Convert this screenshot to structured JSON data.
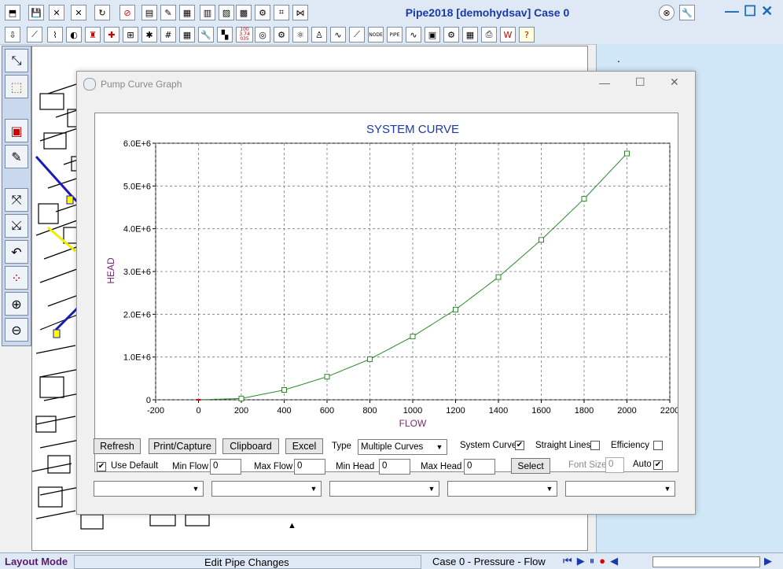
{
  "app": {
    "title": "Pipe2018   [demohydsav]    Case 0",
    "window_controls": {
      "minimize": "—",
      "maximize": "☐",
      "close": "✕"
    }
  },
  "toolbar1_icons": [
    "open-icon",
    "save-icon",
    "delete-pipe-icon",
    "delete-node-icon",
    "refresh-icon",
    "cancel-icon",
    "folder-icon",
    "edit-icon",
    "table-icon",
    "report-icon",
    "chart-icon",
    "notes-icon",
    "tools-icon",
    "map-icon"
  ],
  "toolbar2_icons": [
    "import-icon",
    "pipe-draw-icon",
    "graph-icon",
    "pump-icon",
    "hydrant-icon",
    "valve-icon",
    "grid-icon",
    "network-icon",
    "grid2-icon",
    "color-grid-icon",
    "wrench-icon",
    "checker-icon",
    "numbers-icon",
    "dial-icon",
    "gear-icon",
    "settings-icon",
    "person-icon",
    "wave-icon",
    "ruler-icon",
    "node-icon",
    "pipe-icon",
    "pulse-icon",
    "lock-icon",
    "calendar-icon",
    "printer-icon",
    "word-icon",
    "help-icon"
  ],
  "toolbar2_text": {
    "numbers": "100 3.74 035",
    "node": "NODE",
    "pipe": "PIPE"
  },
  "map_note": ".",
  "dialog": {
    "title": "Pump Curve Graph",
    "buttons": {
      "refresh": "Refresh",
      "print": "Print/Capture",
      "clipboard": "Clipboard",
      "excel": "Excel",
      "select": "Select"
    },
    "type_label": "Type",
    "type_value": "Multiple Curves",
    "system_curve_label": "System Curve",
    "system_curve_checked": true,
    "straight_lines_label": "Straight Lines",
    "straight_lines_checked": false,
    "efficiency_label": "Efficiency",
    "efficiency_checked": false,
    "use_default_label": "Use Default",
    "use_default_checked": true,
    "min_flow_label": "Min Flow",
    "min_flow_value": "0",
    "max_flow_label": "Max Flow",
    "max_flow_value": "0",
    "min_head_label": "Min Head",
    "min_head_value": "0",
    "max_head_label": "Max Head",
    "max_head_value": "0",
    "font_size_label": "Font Size",
    "font_size_value": "0",
    "auto_label": "Auto",
    "auto_checked": true
  },
  "chart_data": {
    "type": "line",
    "title": "SYSTEM CURVE",
    "xlabel": "FLOW",
    "ylabel": "HEAD",
    "xlim": [
      -200,
      2200
    ],
    "ylim": [
      0,
      6000000
    ],
    "x_ticks": [
      "-200",
      "0",
      "200",
      "400",
      "600",
      "800",
      "1000",
      "1200",
      "1400",
      "1600",
      "1800",
      "2000",
      "2200"
    ],
    "y_ticks": [
      "0",
      "1.0E+6",
      "2.0E+6",
      "3.0E+6",
      "4.0E+6",
      "5.0E+6",
      "6.0E+6"
    ],
    "grid": true,
    "series": [
      {
        "color": "#2a8a2a",
        "x": [
          0,
          200,
          400,
          600,
          800,
          1000,
          1200,
          1400,
          1600,
          1800,
          2000
        ],
        "y": [
          0,
          30000,
          230000,
          540000,
          950000,
          1480000,
          2110000,
          2870000,
          3740000,
          4700000,
          5760000
        ]
      }
    ]
  },
  "status": {
    "mode": "Layout Mode",
    "edit": "Edit Pipe Changes",
    "case": "Case 0  -  Pressure  -  Flow"
  },
  "colors": {
    "title_blue": "#1a3aa8",
    "axis_label_purple": "#7a2a7a",
    "curve_green": "#2a8a2a",
    "mode_purple": "#5a1a6a"
  }
}
